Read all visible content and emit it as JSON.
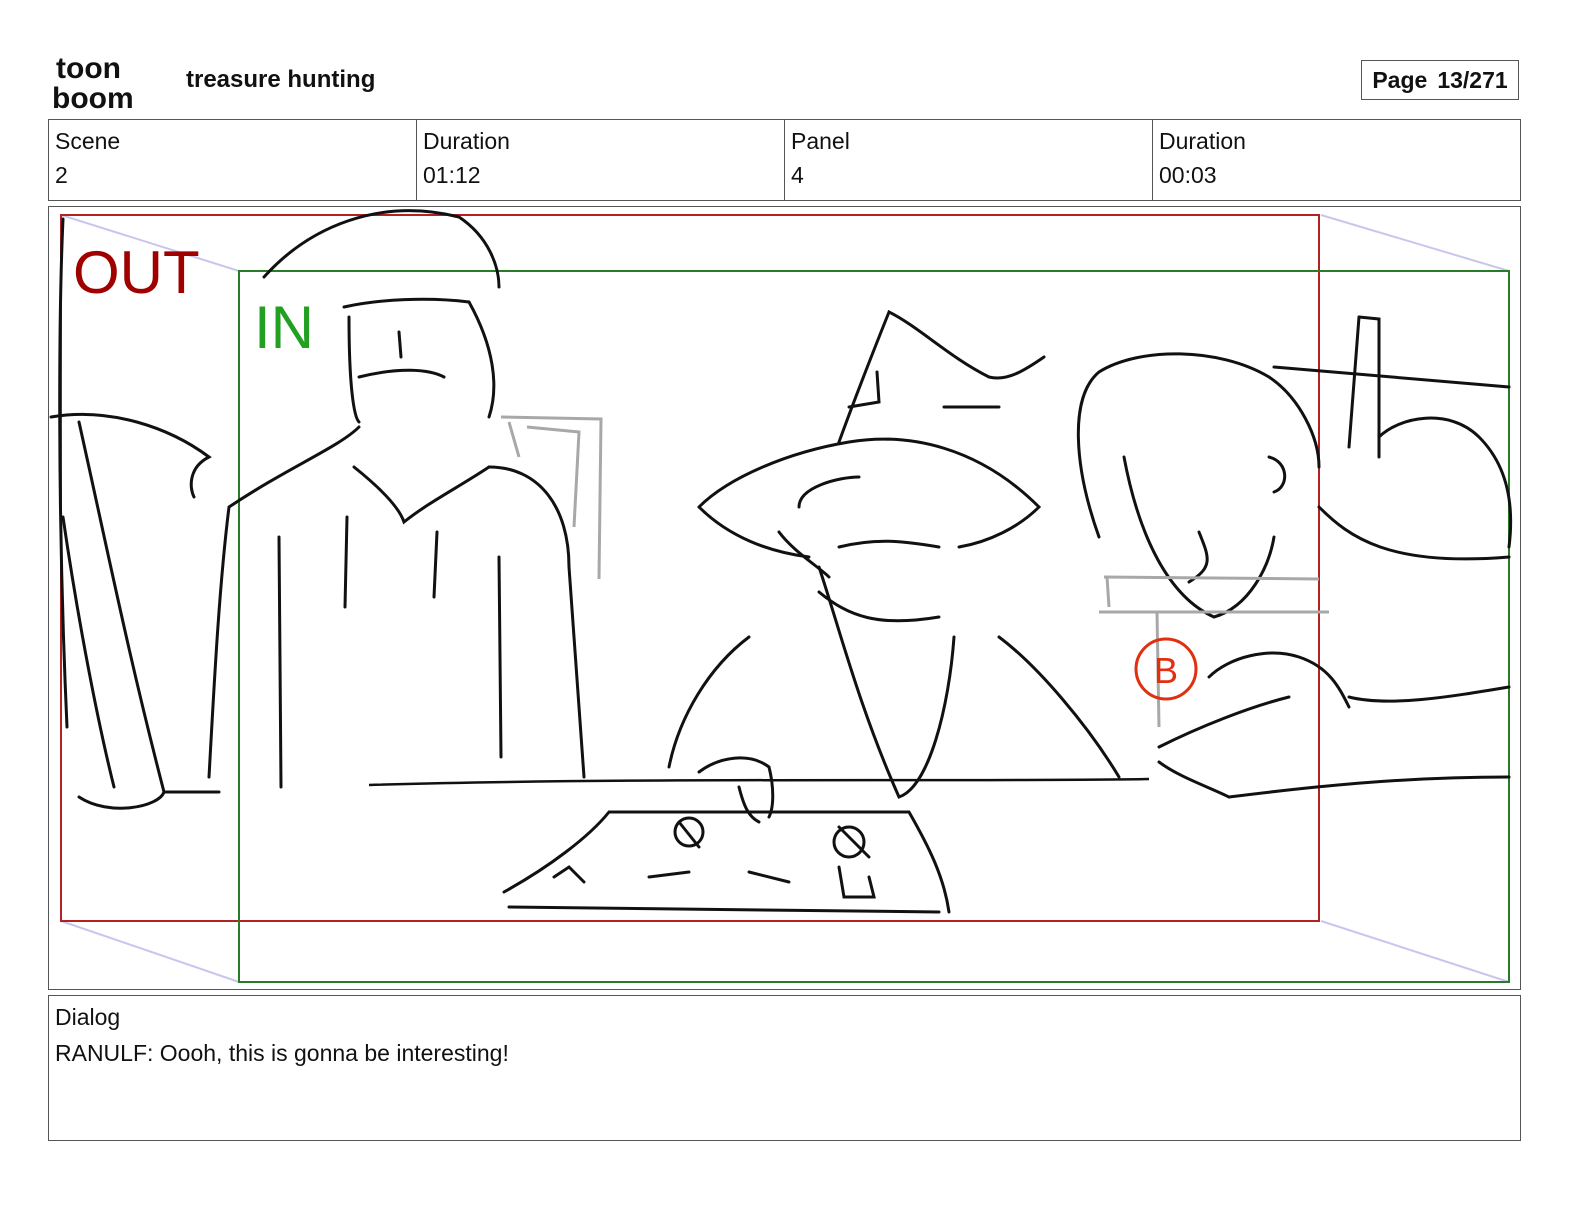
{
  "header": {
    "logo_line1": "toon",
    "logo_line2": "boom",
    "project_title": "treasure hunting",
    "page_label": "Page",
    "page_value": "13/271"
  },
  "info": {
    "scene_label": "Scene",
    "scene_value": "2",
    "scene_duration_label": "Duration",
    "scene_duration_value": "01:12",
    "panel_label": "Panel",
    "panel_value": "4",
    "panel_duration_label": "Duration",
    "panel_duration_value": "00:03"
  },
  "panel": {
    "out_label": "OUT",
    "in_label": "IN",
    "marker_label": "B",
    "out_color": "#b00000",
    "in_color": "#1a8a1a",
    "marker_color": "#e03010"
  },
  "dialog": {
    "label": "Dialog",
    "text": "RANULF: Oooh, this is gonna be interesting!"
  }
}
